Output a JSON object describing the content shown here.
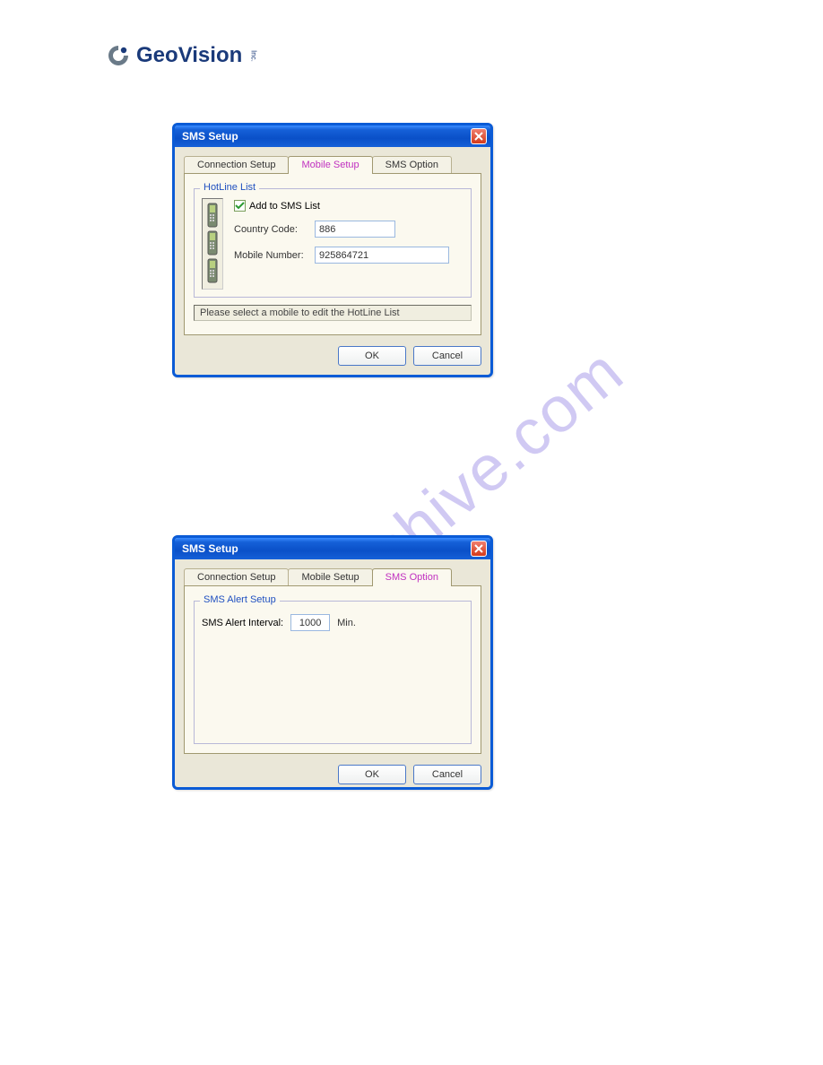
{
  "logo": {
    "text_geo": "Geo",
    "text_vision": "Vision",
    "inc": "Inc."
  },
  "watermark": "manualshive.com",
  "dialog1": {
    "title": "SMS Setup",
    "tabs": {
      "connection": "Connection Setup",
      "mobile": "Mobile Setup",
      "sms_option": "SMS Option"
    },
    "group_title": "HotLine List",
    "add_label": "Add to SMS List",
    "add_checked": true,
    "country_label": "Country Code:",
    "country_value": "886",
    "mobile_label": "Mobile Number:",
    "mobile_value": "925864721",
    "status": "Please select a mobile to edit the HotLine List",
    "ok": "OK",
    "cancel": "Cancel"
  },
  "dialog2": {
    "title": "SMS Setup",
    "tabs": {
      "connection": "Connection Setup",
      "mobile": "Mobile Setup",
      "sms_option": "SMS Option"
    },
    "group_title": "SMS Alert Setup",
    "interval_label": "SMS Alert Interval:",
    "interval_value": "1000",
    "interval_unit": "Min.",
    "ok": "OK",
    "cancel": "Cancel"
  }
}
